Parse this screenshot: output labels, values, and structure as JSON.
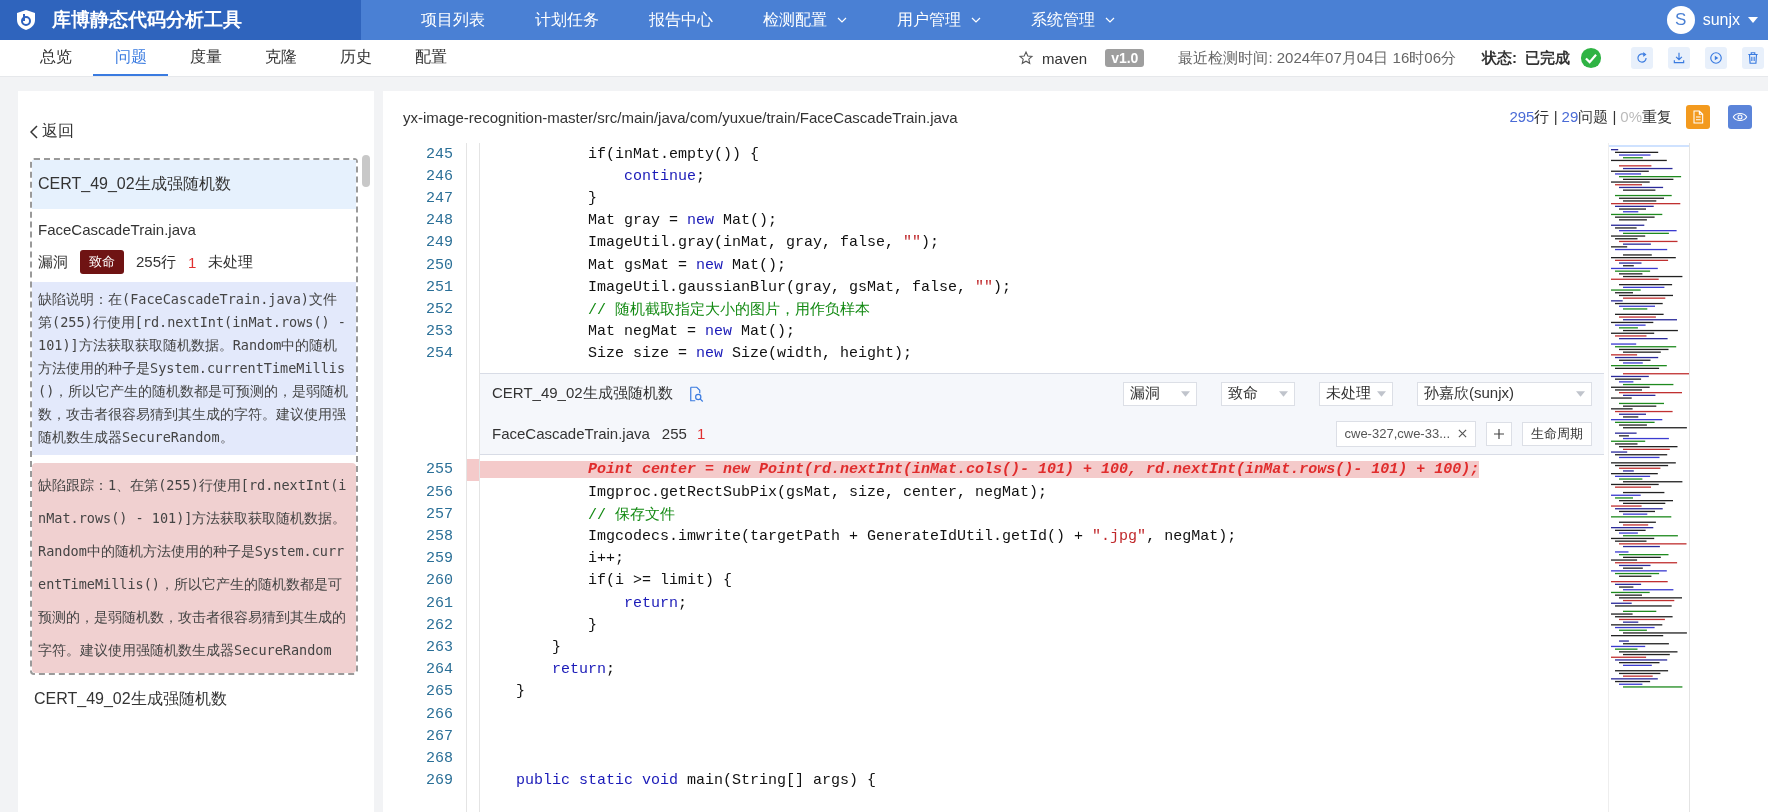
{
  "app": {
    "title": "库博静态代码分析工具"
  },
  "nav": [
    {
      "label": "项目列表",
      "dropdown": false
    },
    {
      "label": "计划任务",
      "dropdown": false
    },
    {
      "label": "报告中心",
      "dropdown": false
    },
    {
      "label": "检测配置",
      "dropdown": true
    },
    {
      "label": "用户管理",
      "dropdown": true
    },
    {
      "label": "系统管理",
      "dropdown": true
    }
  ],
  "user": {
    "initial": "S",
    "name": "sunjx"
  },
  "tabs": [
    {
      "label": "总览",
      "selected": false
    },
    {
      "label": "问题",
      "selected": true
    },
    {
      "label": "度量",
      "selected": false
    },
    {
      "label": "克隆",
      "selected": false
    },
    {
      "label": "历史",
      "selected": false
    },
    {
      "label": "配置",
      "selected": false
    }
  ],
  "project": {
    "name": "maven",
    "version": "v1.0",
    "last_scan": "最近检测时间: 2024年07月04日 16时06分",
    "status_label": "状态:",
    "status": "已完成"
  },
  "left_panel": {
    "back": "返回",
    "issues": [
      {
        "title": "CERT_49_02生成强随机数",
        "selected": true,
        "file": "FaceCascadeTrain.java",
        "type": "漏洞",
        "severity": "致命",
        "line": "255行",
        "count": "1",
        "status": "未处理",
        "description": "缺陷说明：在(FaceCascadeTrain.java)文件第(255)行使用[rd.nextInt(inMat.rows() - 101)]方法获取获取随机数据。Random中的随机方法使用的种子是System.currentTimeMillis()，所以它产生的随机数都是可预测的，是弱随机数，攻击者很容易猜到其生成的字符。建议使用强随机数生成器SecureRandom。",
        "trace": "缺陷跟踪：1、在第(255)行使用[rd.nextInt(inMat.rows() - 101)]方法获取获取随机数据。Random中的随机方法使用的种子是System.currentTimeMillis()，所以它产生的随机数都是可预测的，是弱随机数，攻击者很容易猜到其生成的字符。建议使用强随机数生成器SecureRandom"
      },
      {
        "title": "CERT_49_02生成强随机数",
        "selected": false
      }
    ]
  },
  "code_panel": {
    "path": "yx-image-recognition-master/src/main/java/com/yuxue/train/FaceCascadeTrain.java",
    "lines_count": "295",
    "lines_unit": "行 |",
    "issues_count": "29",
    "issues_unit": "问题 |",
    "dup_pct": "0%",
    "dup_unit": "重复",
    "lines_before": [
      {
        "number": "245",
        "highlighted": false,
        "tokens": [
          {
            "kind": "plain",
            "text": "            if(inMat.empty()) {"
          }
        ]
      },
      {
        "number": "246",
        "highlighted": false,
        "tokens": [
          {
            "kind": "keyword",
            "text": "                continue"
          },
          {
            "kind": "plain",
            "text": ";"
          }
        ]
      },
      {
        "number": "247",
        "highlighted": false,
        "tokens": [
          {
            "kind": "plain",
            "text": "            }"
          }
        ]
      },
      {
        "number": "248",
        "highlighted": false,
        "tokens": [
          {
            "kind": "plain",
            "text": "            Mat gray = "
          },
          {
            "kind": "keyword",
            "text": "new"
          },
          {
            "kind": "plain",
            "text": " Mat();"
          }
        ]
      },
      {
        "number": "249",
        "highlighted": false,
        "tokens": [
          {
            "kind": "plain",
            "text": "            ImageUtil.gray(inMat, gray, false, "
          },
          {
            "kind": "string",
            "text": "\"\""
          },
          {
            "kind": "plain",
            "text": ");"
          }
        ]
      },
      {
        "number": "250",
        "highlighted": false,
        "tokens": [
          {
            "kind": "plain",
            "text": "            Mat gsMat = "
          },
          {
            "kind": "keyword",
            "text": "new"
          },
          {
            "kind": "plain",
            "text": " Mat();"
          }
        ]
      },
      {
        "number": "251",
        "highlighted": false,
        "tokens": [
          {
            "kind": "plain",
            "text": "            ImageUtil.gaussianBlur(gray, gsMat, false, "
          },
          {
            "kind": "string",
            "text": "\"\""
          },
          {
            "kind": "plain",
            "text": ");"
          }
        ]
      },
      {
        "number": "252",
        "highlighted": false,
        "tokens": [
          {
            "kind": "comment",
            "text": "            // 随机截取指定大小的图片，用作负样本"
          }
        ]
      },
      {
        "number": "253",
        "highlighted": false,
        "tokens": [
          {
            "kind": "plain",
            "text": "            Mat negMat = "
          },
          {
            "kind": "keyword",
            "text": "new"
          },
          {
            "kind": "plain",
            "text": " Mat();"
          }
        ]
      },
      {
        "number": "254",
        "highlighted": false,
        "tokens": [
          {
            "kind": "plain",
            "text": "            Size size = "
          },
          {
            "kind": "keyword",
            "text": "new"
          },
          {
            "kind": "plain",
            "text": " Size(width, height);"
          }
        ]
      }
    ],
    "issue_popup": {
      "title": "CERT_49_02生成强随机数",
      "type": "漏洞",
      "severity": "致命",
      "status": "未处理",
      "assignee": "孙嘉欣(sunjx)",
      "file": "FaceCascadeTrain.java",
      "line": "255",
      "count": "1",
      "tags": "cwe-327,cwe-33...",
      "lifecycle": "生命周期"
    },
    "lines_after": [
      {
        "number": "255",
        "highlighted": true,
        "tokens": [
          {
            "kind": "plain",
            "text": "            Point center = new Point(rd.nextInt(inMat.cols()- 101) + 100, rd.nextInt(inMat.rows()- 101) + 100);"
          }
        ]
      },
      {
        "number": "256",
        "highlighted": false,
        "tokens": [
          {
            "kind": "plain",
            "text": "            Imgproc.getRectSubPix(gsMat, size, center, negMat);"
          }
        ]
      },
      {
        "number": "257",
        "highlighted": false,
        "tokens": [
          {
            "kind": "comment",
            "text": "            // 保存文件"
          }
        ]
      },
      {
        "number": "258",
        "highlighted": false,
        "tokens": [
          {
            "kind": "plain",
            "text": "            Imgcodecs.imwrite(targetPath + GenerateIdUtil.getId() + "
          },
          {
            "kind": "string",
            "text": "\".jpg\""
          },
          {
            "kind": "plain",
            "text": ", negMat);"
          }
        ]
      },
      {
        "number": "259",
        "highlighted": false,
        "tokens": [
          {
            "kind": "plain",
            "text": "            i++;"
          }
        ]
      },
      {
        "number": "260",
        "highlighted": false,
        "tokens": [
          {
            "kind": "plain",
            "text": "            if(i >= limit) {"
          }
        ]
      },
      {
        "number": "261",
        "highlighted": false,
        "tokens": [
          {
            "kind": "keyword",
            "text": "                return"
          },
          {
            "kind": "plain",
            "text": ";"
          }
        ]
      },
      {
        "number": "262",
        "highlighted": false,
        "tokens": [
          {
            "kind": "plain",
            "text": "            }"
          }
        ]
      },
      {
        "number": "263",
        "highlighted": false,
        "tokens": [
          {
            "kind": "plain",
            "text": "        }"
          }
        ]
      },
      {
        "number": "264",
        "highlighted": false,
        "tokens": [
          {
            "kind": "keyword",
            "text": "        return"
          },
          {
            "kind": "plain",
            "text": ";"
          }
        ]
      },
      {
        "number": "265",
        "highlighted": false,
        "tokens": [
          {
            "kind": "plain",
            "text": "    }"
          }
        ]
      },
      {
        "number": "266",
        "highlighted": false
      },
      {
        "number": "267",
        "highlighted": false
      },
      {
        "number": "268",
        "highlighted": false
      },
      {
        "number": "269",
        "highlighted": false,
        "tokens": [
          {
            "kind": "keyword",
            "text": "    public static void"
          },
          {
            "kind": "plain",
            "text": " main(String[] args) {"
          }
        ]
      }
    ]
  }
}
